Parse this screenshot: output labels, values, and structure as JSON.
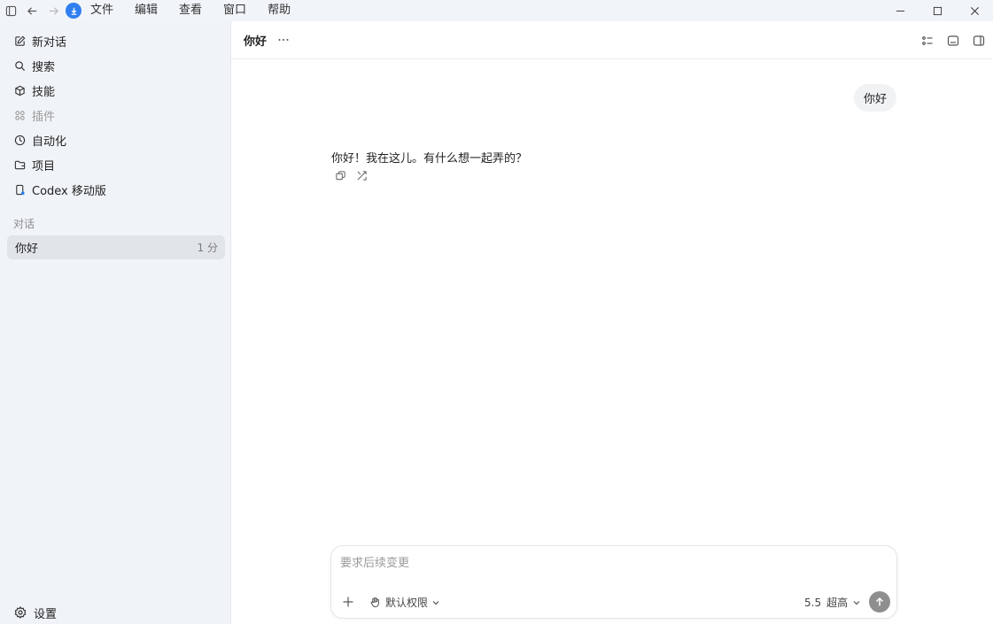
{
  "menu": {
    "items": [
      "文件",
      "编辑",
      "查看",
      "窗口",
      "帮助"
    ]
  },
  "icons": {
    "sidebar_toggle": "sidebar-toggle-icon",
    "back": "arrow-left-icon",
    "forward": "arrow-right-icon",
    "update": "download-icon",
    "minimize": "minimize-icon",
    "maximize": "maximize-icon",
    "close": "close-icon"
  },
  "colors": {
    "accent": "#2f7ff0",
    "sidebar_bg": "#f0f4f8",
    "selected_item_bg": "#e1e5ea",
    "send_button": "#8e8e8e"
  },
  "sidebar": {
    "nav": [
      {
        "label": "新对话",
        "icon": "compose-icon",
        "disabled": false
      },
      {
        "label": "搜索",
        "icon": "search-icon",
        "disabled": false
      },
      {
        "label": "技能",
        "icon": "cube-icon",
        "disabled": false
      },
      {
        "label": "插件",
        "icon": "grid-icon",
        "disabled": true
      },
      {
        "label": "自动化",
        "icon": "clock-icon",
        "disabled": false
      },
      {
        "label": "项目",
        "icon": "folder-icon",
        "disabled": false
      },
      {
        "label": "Codex 移动版",
        "icon": "phone-icon",
        "disabled": false
      }
    ],
    "section_label": "对话",
    "conversations": [
      {
        "title": "你好",
        "time": "1 分"
      }
    ],
    "settings_label": "设置"
  },
  "main": {
    "title": "你好",
    "user_message": "你好",
    "assistant_message": "你好！我在这儿。有什么想一起弄的？"
  },
  "composer": {
    "placeholder": "要求后续变更",
    "value": "",
    "permission_label": "默认权限",
    "model_version": "5.5",
    "model_level": "超高"
  }
}
